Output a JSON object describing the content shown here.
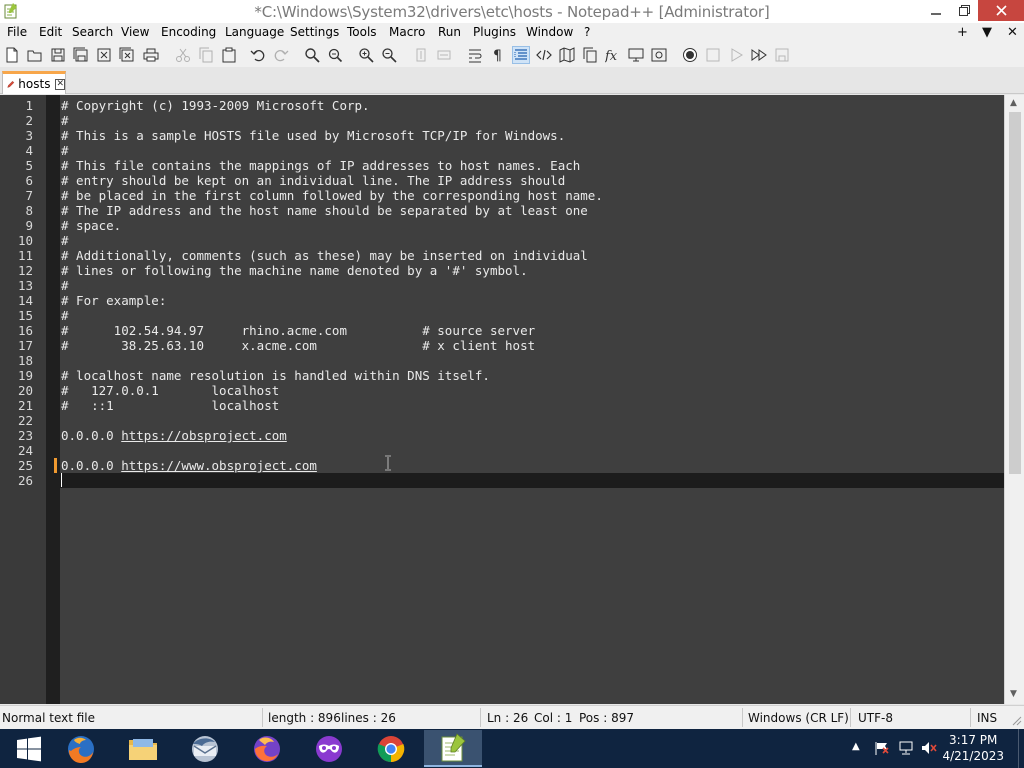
{
  "window": {
    "title": "*C:\\Windows\\System32\\drivers\\etc\\hosts - Notepad++ [Administrator]",
    "controls": {
      "minimize": "–",
      "maximize": "❐",
      "close": "✕"
    }
  },
  "menubar": {
    "items": [
      "File",
      "Edit",
      "Search",
      "View",
      "Encoding",
      "Language",
      "Settings",
      "Tools",
      "Macro",
      "Run",
      "Plugins",
      "Window",
      "?"
    ],
    "right_controls": [
      "+",
      "▼",
      "✕"
    ]
  },
  "toolbar": {
    "buttons": [
      "new-file",
      "open-file",
      "save",
      "save-all",
      "close",
      "close-all",
      "print",
      "cut",
      "copy",
      "paste",
      "undo",
      "redo",
      "find",
      "replace",
      "zoom-in",
      "zoom-out",
      "sync-vertical",
      "sync-horizontal",
      "word-wrap",
      "show-all-characters",
      "indent-guide",
      "xml-tag",
      "document-map",
      "function-list",
      "folder-as-workspace",
      "monitoring",
      "start-recording",
      "stop-recording",
      "playback",
      "run-macro-multiple",
      "save-macro"
    ],
    "active": "indent-guide"
  },
  "tabs": [
    {
      "label": "hosts",
      "close": "✕",
      "modified": true
    }
  ],
  "editor": {
    "current_line": 26,
    "lines": [
      "# Copyright (c) 1993-2009 Microsoft Corp.",
      "#",
      "# This is a sample HOSTS file used by Microsoft TCP/IP for Windows.",
      "#",
      "# This file contains the mappings of IP addresses to host names. Each",
      "# entry should be kept on an individual line. The IP address should",
      "# be placed in the first column followed by the corresponding host name.",
      "# The IP address and the host name should be separated by at least one",
      "# space.",
      "#",
      "# Additionally, comments (such as these) may be inserted on individual",
      "# lines or following the machine name denoted by a '#' symbol.",
      "#",
      "# For example:",
      "#",
      "#      102.54.94.97     rhino.acme.com          # source server",
      "#       38.25.63.10     x.acme.com              # x client host",
      "",
      "# localhost name resolution is handled within DNS itself.",
      "#   127.0.0.1       localhost",
      "#   ::1             localhost",
      "",
      "0.0.0.0 ",
      "",
      "0.0.0.0 ",
      ""
    ],
    "urls": {
      "23": "https://obsproject.com",
      "25": "https://www.obsproject.com"
    },
    "line_numbers": [
      "1",
      "2",
      "3",
      "4",
      "5",
      "6",
      "7",
      "8",
      "9",
      "10",
      "11",
      "12",
      "13",
      "14",
      "15",
      "16",
      "17",
      "18",
      "19",
      "20",
      "21",
      "22",
      "23",
      "24",
      "25",
      "26"
    ],
    "changed_lines": [
      25
    ]
  },
  "statusbar": {
    "file_type": "Normal text file",
    "length": "length : 896",
    "lines": "lines : 26",
    "ln": "Ln : 26",
    "col": "Col : 1",
    "pos": "Pos : 897",
    "eol": "Windows (CR LF)",
    "encoding": "UTF-8",
    "mode": "INS"
  },
  "taskbar": {
    "apps": [
      "start",
      "firefox-developer",
      "file-explorer",
      "thunderbird",
      "firefox",
      "tor-privacy",
      "chrome",
      "notepad-plus-plus"
    ],
    "active_app": "notepad-plus-plus",
    "tray": [
      "show-hidden-icons",
      "action-center-flag",
      "network",
      "volume-muted"
    ],
    "time": "3:17 PM",
    "date": "4/21/2023"
  },
  "colors": {
    "editor_bg": "#3f3f3f",
    "current_line_bg": "#1c1c1c",
    "fold_margin": "#1f1f1f",
    "change_marker": "#f09a30",
    "tab_accent": "#f7a64a",
    "taskbar_bg": "#0f2440",
    "close_button": "#c7463f"
  }
}
